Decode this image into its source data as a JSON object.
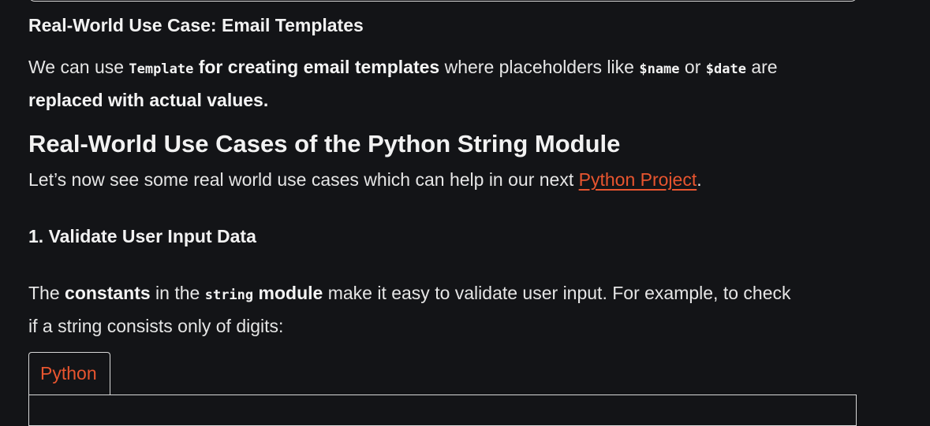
{
  "section1": {
    "heading": "Real-World Use Case: Email Templates",
    "para": {
      "t1": "We can use ",
      "code1": "Template",
      "b1": " for creating email templates",
      "t2": " where placeholders like ",
      "code2": "$name",
      "t3": " or ",
      "code3": "$date",
      "t4": " are",
      "b2": "replaced with actual values."
    }
  },
  "section2": {
    "heading": "Real-World Use Cases of the Python String Module",
    "intro": {
      "t1": "Let’s now see some real world use cases which can help in our next ",
      "link": "Python Project",
      "t2": "."
    }
  },
  "section3": {
    "heading": "1. Validate User Input Data",
    "para": {
      "t1": "The ",
      "b1": "constants",
      "t2": " in the ",
      "code1": "string",
      "b2": " module",
      "t3": " make it easy to validate user input. For example, to check",
      "line2": "if a string consists only of digits:"
    }
  },
  "code_block": {
    "tab_label": "Python"
  },
  "colors": {
    "background": "#131417",
    "accent": "#e8552f"
  }
}
